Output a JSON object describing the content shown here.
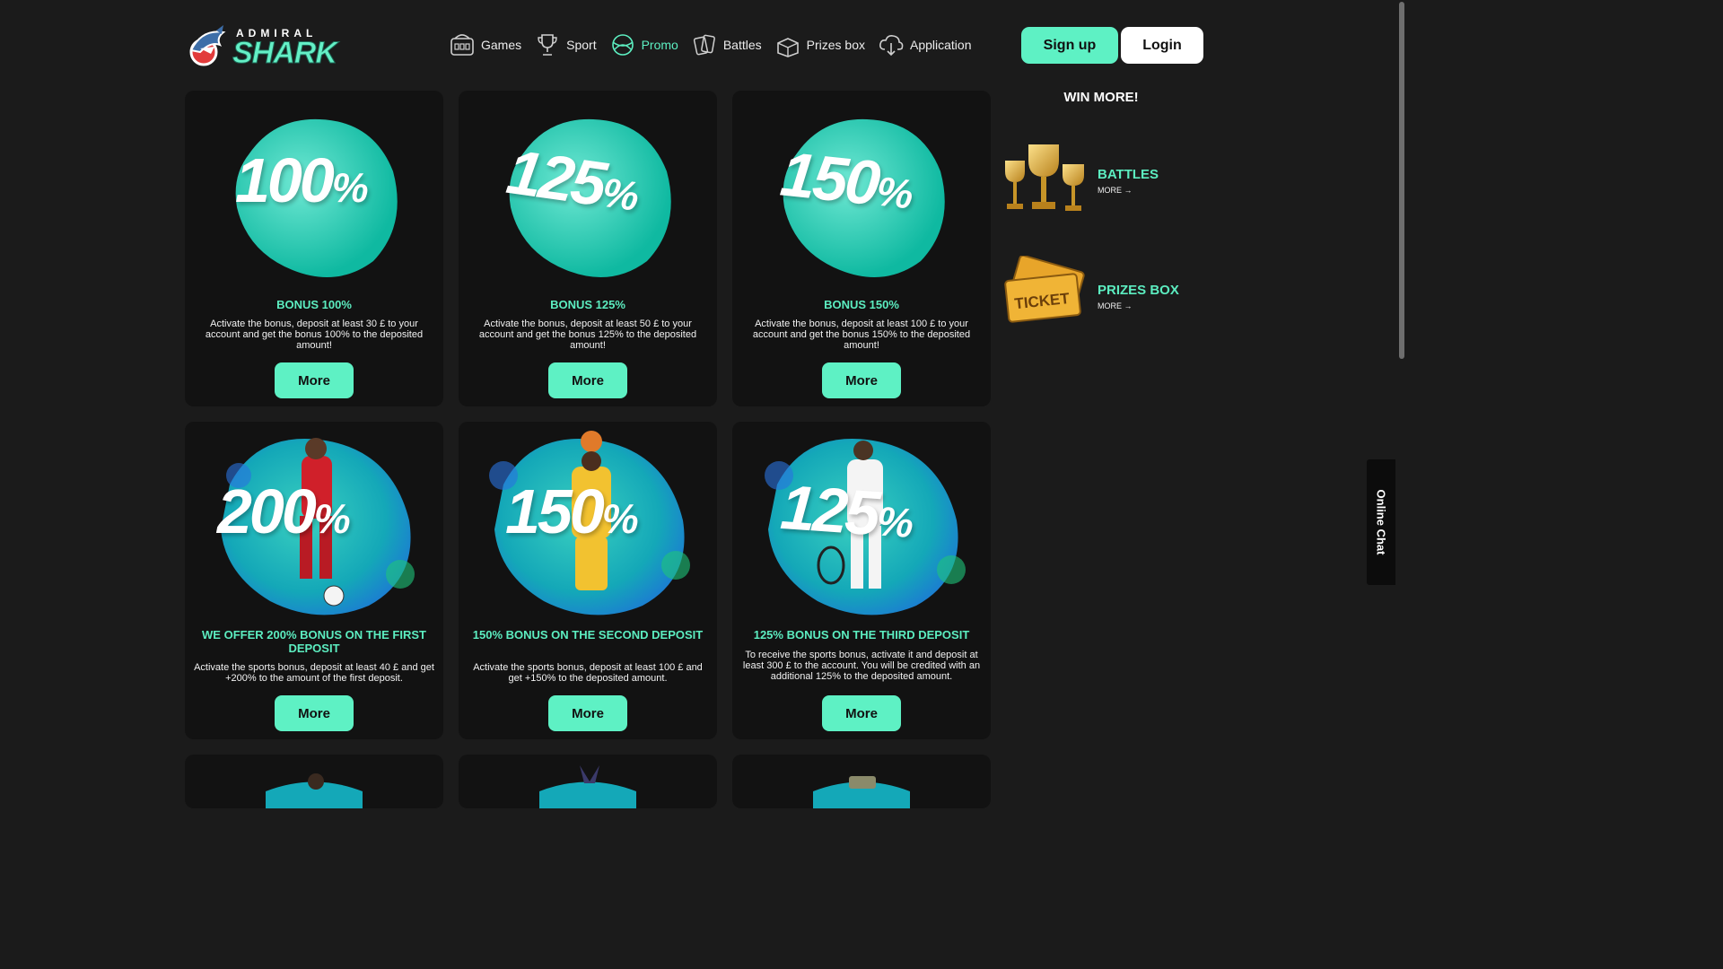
{
  "logo": {
    "top_text": "ADMIRAL",
    "main_text": "SHARK"
  },
  "nav": [
    {
      "label": "Games",
      "icon": "slot-machine-icon"
    },
    {
      "label": "Sport",
      "icon": "trophy-icon"
    },
    {
      "label": "Promo",
      "icon": "promo-ribbon-icon",
      "active": true
    },
    {
      "label": "Battles",
      "icon": "cards-icon"
    },
    {
      "label": "Prizes box",
      "icon": "chest-icon"
    },
    {
      "label": "Application",
      "icon": "download-cloud-icon"
    }
  ],
  "auth": {
    "signup_label": "Sign up",
    "login_label": "Login"
  },
  "cards": [
    {
      "percent": "100",
      "title": "BONUS 100%",
      "text": "Activate the bonus, deposit at least 30 £ to your account and get the bonus 100% to the deposited amount!",
      "button": "More"
    },
    {
      "percent": "125",
      "title": "BONUS 125%",
      "text": "Activate the bonus, deposit at least 50 £ to your account and get the bonus 125% to the deposited amount!",
      "button": "More"
    },
    {
      "percent": "150",
      "title": "BONUS 150%",
      "text": "Activate the bonus, deposit at least 100 £ to your account and get the bonus 150% to the deposited amount!",
      "button": "More"
    },
    {
      "percent": "200",
      "title": "WE OFFER 200% BONUS ON THE FIRST DEPOSIT",
      "text": "Activate the sports bonus, deposit at least 40 £ and get +200% to the amount of the first deposit.",
      "button": "More"
    },
    {
      "percent": "150",
      "title": "150% BONUS ON THE SECOND DEPOSIT",
      "text": "Activate the sports bonus, deposit at least 100 £ and get +150% to the deposited amount.",
      "button": "More"
    },
    {
      "percent": "125",
      "title": "125% BONUS ON THE THIRD DEPOSIT",
      "text": "To receive the sports bonus, activate it and deposit at least 300 £ to the account. You will be credited with an additional 125% to the deposited amount.",
      "button": "More"
    }
  ],
  "sidebar": {
    "title": "WIN MORE!",
    "items": [
      {
        "label": "BATTLES",
        "more": "MORE →",
        "icon": "trophies-icon"
      },
      {
        "label": "PRIZES BOX",
        "more": "MORE →",
        "icon": "tickets-icon"
      }
    ]
  },
  "chat": {
    "label": "Online Chat"
  },
  "colors": {
    "accent": "#5ef1c4",
    "background": "#1b1b1b",
    "card": "#121212"
  }
}
